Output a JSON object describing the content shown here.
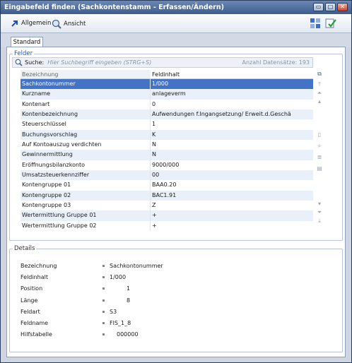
{
  "window": {
    "title": "Eingabefeld finden (Sachkontenstamm - Erfassen/Ändern)"
  },
  "title_buttons": {
    "minimize": "▭",
    "maximize": "□",
    "close": "✕"
  },
  "toolbar": {
    "allgemein_label": "Allgemein",
    "ansicht_label": "Ansicht"
  },
  "tabs": [
    {
      "label": "Standard"
    }
  ],
  "felder": {
    "legend": "Felder",
    "search": {
      "label": "Suche:",
      "placeholder": "Hier Suchbegriff eingeben (STRG+S)",
      "count_text": "Anzahl Datensätze: 193"
    },
    "columns": [
      "Bezeichnung",
      "Feldinhalt"
    ],
    "rows": [
      [
        "Sachkontonummer",
        "1/000"
      ],
      [
        "Kurzname",
        "anlageverm"
      ],
      [
        "Kontenart",
        "0"
      ],
      [
        "Kontenbezeichnung",
        "Aufwendungen f.Ingangsetzung/ Erweit.d.Geschä"
      ],
      [
        "Steuerschlüssel",
        "1"
      ],
      [
        "Buchungsvorschlag",
        "K"
      ],
      [
        "Auf Kontoauszug verdichten",
        "N"
      ],
      [
        "Gewinnermittlung",
        "N"
      ],
      [
        "Eröffnungsbilanzkonto",
        "9000/000"
      ],
      [
        "Umsatzsteuerkennziffer",
        "00"
      ],
      [
        "Kontengruppe 01",
        "BAA0.20"
      ],
      [
        "Kontengruppe 02",
        "BAC1.91"
      ],
      [
        "Kontengruppe 03",
        "Z"
      ],
      [
        "Wertermittlung Gruppe 01",
        "+"
      ],
      [
        "Wertermittlung Gruppe 02",
        "+"
      ]
    ]
  },
  "details": {
    "legend": "Details",
    "rows": [
      [
        "Bezeichnung",
        "Sachkontonummer"
      ],
      [
        "Feldinhalt",
        "1/000"
      ],
      [
        "Position",
        "1"
      ],
      [
        "Länge",
        "8"
      ],
      [
        "Feldart",
        "S3"
      ],
      [
        "Feldname",
        "FIS_1_8"
      ],
      [
        "Hilfstabelle",
        "000000"
      ]
    ]
  },
  "colors": {
    "selection": "#4373c7",
    "legend_accent": "#1a58c8",
    "title_bar": "#3d5c8f"
  }
}
